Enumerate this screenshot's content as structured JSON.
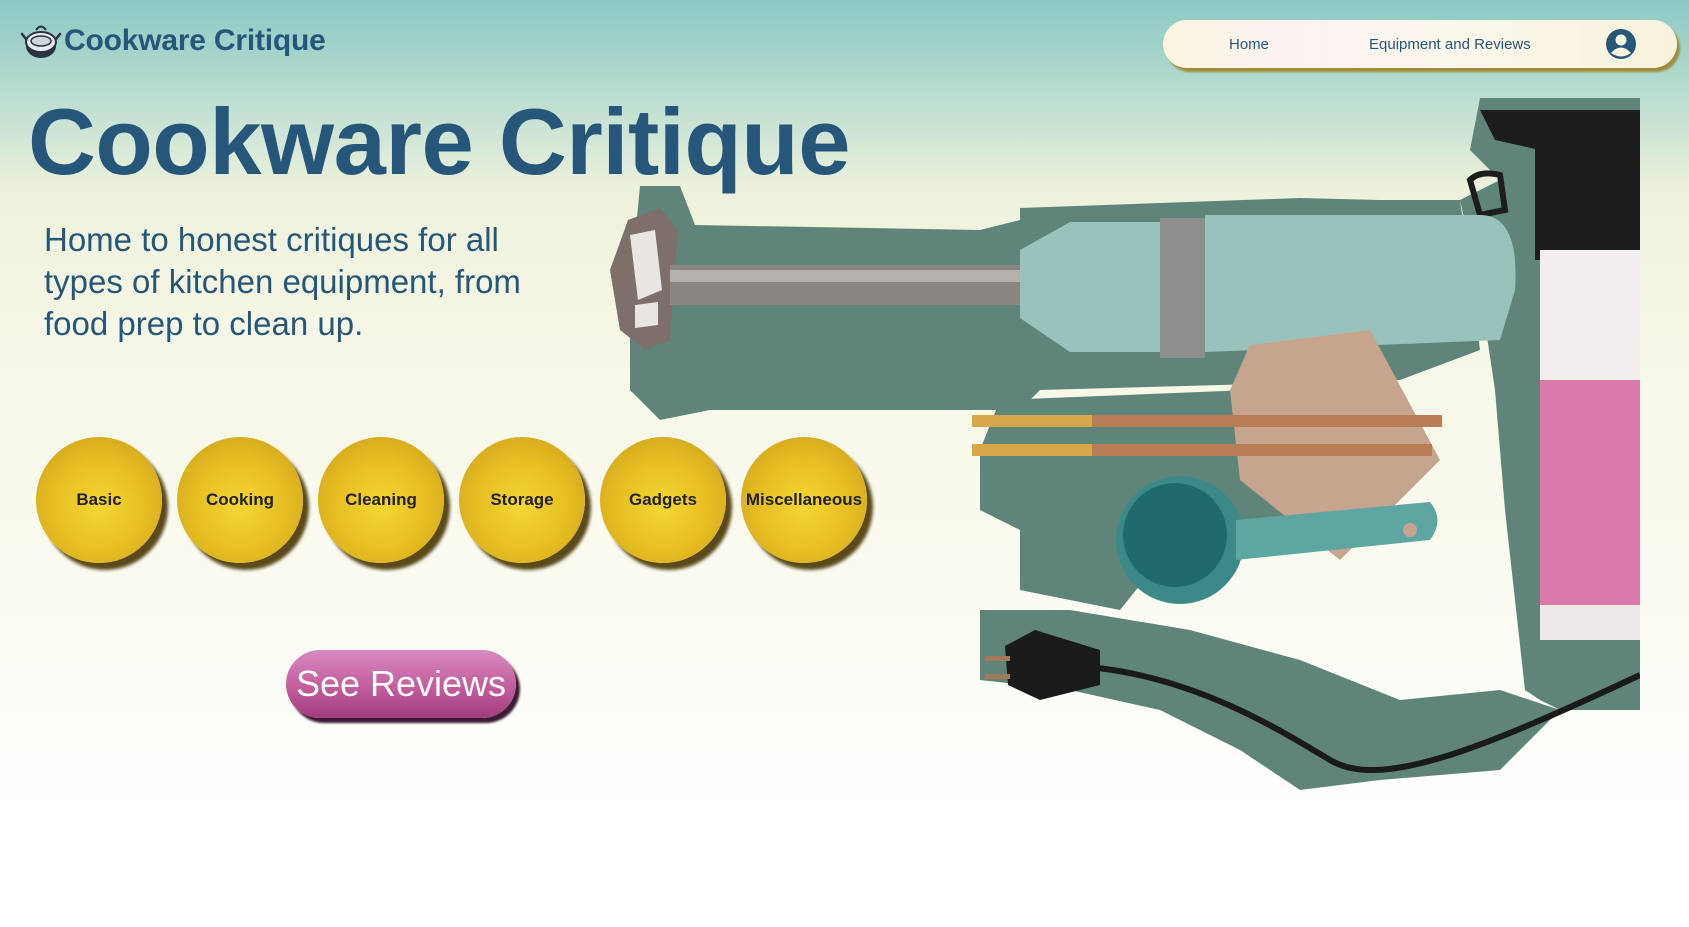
{
  "header": {
    "brand_name": "Cookware Critique",
    "logo_icon": "cooking-pot-logo-icon"
  },
  "nav": {
    "home_label": "Home",
    "equipment_label": "Equipment and Reviews",
    "user_icon": "user-circle-icon"
  },
  "hero": {
    "title": "Cookware Critique",
    "tagline": "Home to honest critiques for all types of kitchen equipment, from food prep to clean up."
  },
  "categories": [
    {
      "label": "Basic"
    },
    {
      "label": "Cooking"
    },
    {
      "label": "Cleaning"
    },
    {
      "label": "Storage"
    },
    {
      "label": "Gadgets"
    },
    {
      "label": "Miscellaneous"
    }
  ],
  "cta": {
    "label": "See Reviews"
  },
  "illustration": {
    "icon": "kitchen-equipment-collage-icon",
    "items": [
      "immersion-blender",
      "chopsticks",
      "measuring-scoop",
      "parchment-paper",
      "spray-bottle",
      "power-cord"
    ]
  },
  "colors": {
    "brand_blue": "#26577a",
    "category_gold": "#e6be22",
    "cta_pink": "#c35d9c",
    "nav_bg": "#fbf6e0"
  }
}
